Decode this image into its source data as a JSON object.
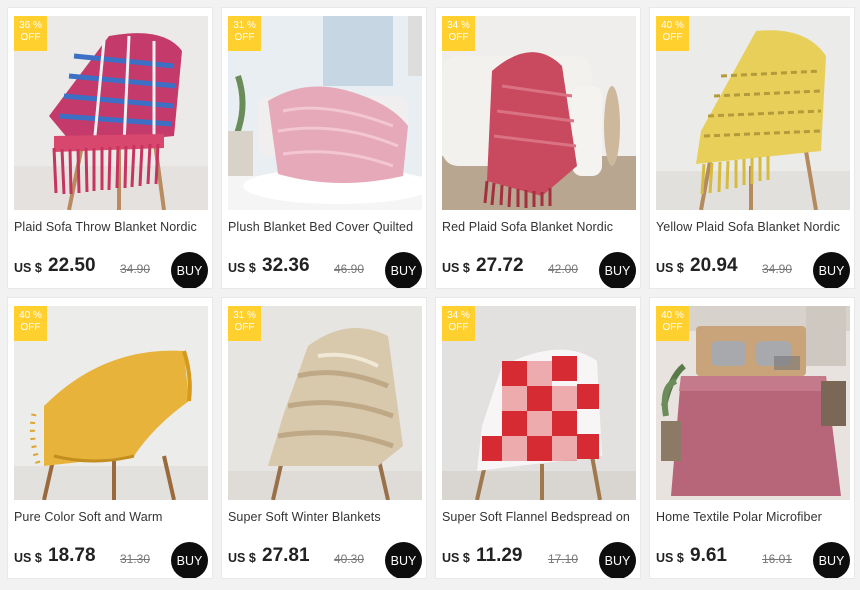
{
  "products": [
    {
      "discount_pct": "36 %",
      "discount_off": "OFF",
      "title": "Plaid Sofa Throw Blanket Nordic",
      "currency": "US $",
      "price": "22.50",
      "old_price": "34.90",
      "buy_label": "BUY"
    },
    {
      "discount_pct": "31 %",
      "discount_off": "OFF",
      "title": "Plush Blanket Bed Cover Quilted",
      "currency": "US $",
      "price": "32.36",
      "old_price": "46.90",
      "buy_label": "BUY"
    },
    {
      "discount_pct": "34 %",
      "discount_off": "OFF",
      "title": "Red Plaid Sofa Blanket Nordic",
      "currency": "US $",
      "price": "27.72",
      "old_price": "42.00",
      "buy_label": "BUY"
    },
    {
      "discount_pct": "40 %",
      "discount_off": "OFF",
      "title": "Yellow Plaid Sofa Blanket Nordic",
      "currency": "US $",
      "price": "20.94",
      "old_price": "34.90",
      "buy_label": "BUY"
    },
    {
      "discount_pct": "40 %",
      "discount_off": "OFF",
      "title": "Pure Color Soft and Warm",
      "currency": "US $",
      "price": "18.78",
      "old_price": "31.30",
      "buy_label": "BUY"
    },
    {
      "discount_pct": "31 %",
      "discount_off": "OFF",
      "title": "Super Soft Winter Blankets",
      "currency": "US $",
      "price": "27.81",
      "old_price": "40.30",
      "buy_label": "BUY"
    },
    {
      "discount_pct": "34 %",
      "discount_off": "OFF",
      "title": "Super Soft Flannel Bedspread on",
      "currency": "US $",
      "price": "11.29",
      "old_price": "17.10",
      "buy_label": "BUY"
    },
    {
      "discount_pct": "40 %",
      "discount_off": "OFF",
      "title": "Home Textile Polar Microfiber",
      "currency": "US $",
      "price": "9.61",
      "old_price": "16.01",
      "buy_label": "BUY"
    }
  ],
  "colors": {
    "badge": "#ffd02e",
    "buy_button": "#0d0d0d"
  }
}
